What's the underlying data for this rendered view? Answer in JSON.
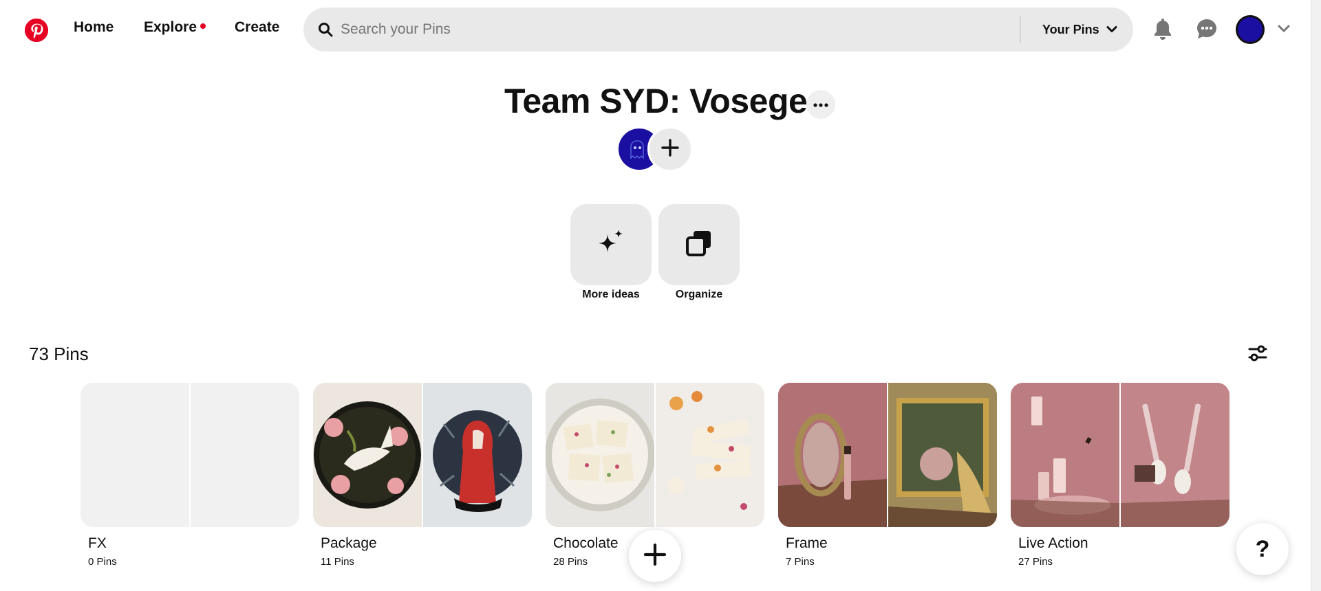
{
  "header": {
    "logo_icon": "pinterest-logo",
    "nav": [
      {
        "label": "Home"
      },
      {
        "label": "Explore"
      },
      {
        "label": "Create"
      }
    ],
    "search": {
      "placeholder": "Search your Pins",
      "value": "",
      "icon": "search-icon",
      "scope_label": "Your Pins",
      "scope_icon": "chevron-down-icon"
    },
    "icons": [
      "bell-icon",
      "message-icon",
      "avatar",
      "chevron-down-icon"
    ]
  },
  "board": {
    "title": "Team SYD: Voseges",
    "more_icon": "ellipsis-icon",
    "add_collaborator_icon": "plus-icon"
  },
  "actions": [
    {
      "label": "More ideas",
      "icon": "sparkle-icon"
    },
    {
      "label": "Organize",
      "icon": "organize-icon"
    }
  ],
  "pins_header": {
    "count_label": "73 Pins",
    "filter_icon": "filter-icon"
  },
  "sections": [
    {
      "name": "FX",
      "count": "0 Pins"
    },
    {
      "name": "Package",
      "count": "11 Pins"
    },
    {
      "name": "Chocolate",
      "count": "28 Pins"
    },
    {
      "name": "Frame",
      "count": "7 Pins"
    },
    {
      "name": "Live Action",
      "count": "27 Pins"
    }
  ],
  "floating": {
    "add_icon": "plus-icon",
    "help_label": "?"
  },
  "colors": {
    "brand": "#e60023",
    "surface": "#e9e9e9",
    "avatar": "#1a0fa0"
  }
}
